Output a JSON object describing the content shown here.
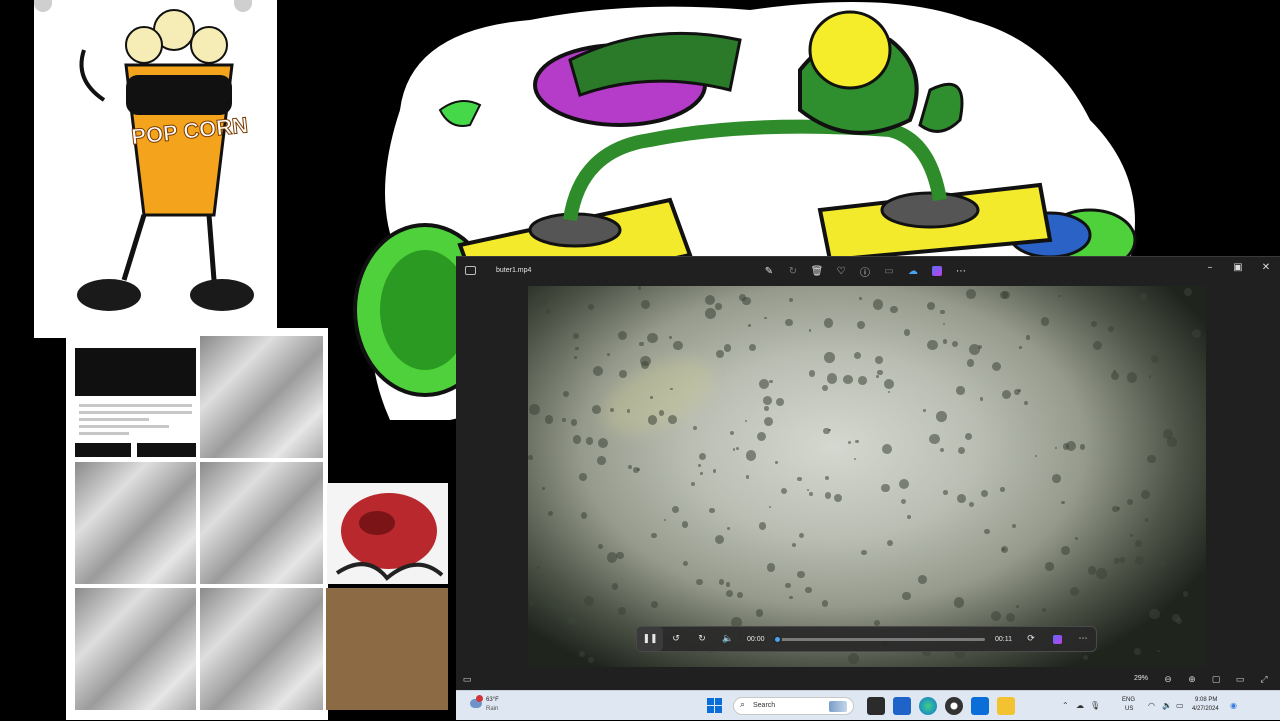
{
  "player": {
    "file_name": "buter1.mp4",
    "current_time": "00:00",
    "duration": "00:11",
    "progress_fraction": 0.01,
    "zoom_level": "29%",
    "title_tools": [
      "edit-icon",
      "rotate-icon",
      "delete-icon",
      "favorite-icon",
      "info-icon",
      "caption-icon",
      "share-icon",
      "copilot-icon",
      "more-icon"
    ],
    "window_controls": [
      "minimize-icon",
      "maximize-icon",
      "close-icon"
    ],
    "playback_controls": [
      "pause-icon",
      "skip-back-icon",
      "skip-forward-icon",
      "volume-icon"
    ],
    "accent_color": "#4aa3f0"
  },
  "taskbar": {
    "weather_temp": "63°F",
    "weather_condition": "Rain",
    "search_placeholder": "Search",
    "language": "ENG",
    "region": "US",
    "clock_time": "9:08 PM",
    "clock_date": "4/27/2024"
  },
  "background": {
    "popcorn_text": "POP CORN"
  }
}
